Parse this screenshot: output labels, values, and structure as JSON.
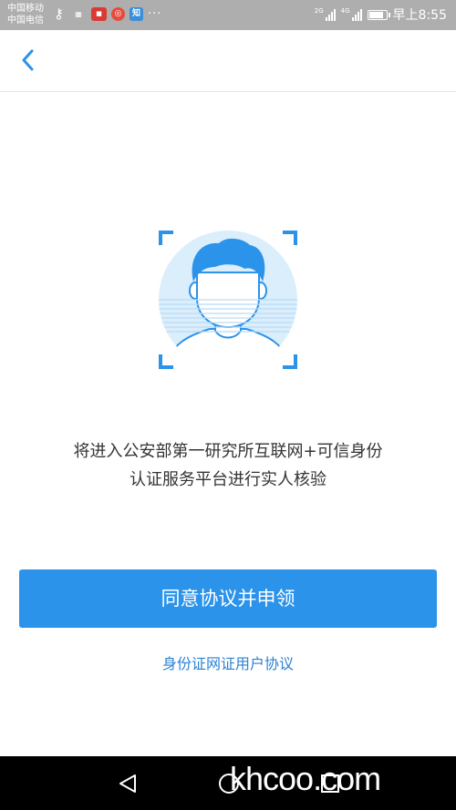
{
  "status_bar": {
    "carrier_1": "中国移动",
    "carrier_2": "中国电信",
    "net_label_1": "2G",
    "net_label_2": "4G",
    "time": "早上8:55",
    "battery_level": 0.85
  },
  "nav": {
    "back_icon": "chevron-left-icon"
  },
  "illustration": {
    "icon": "face-scan-icon",
    "accent_color": "#2c93ea"
  },
  "content": {
    "description_line1": "将进入公安部第一研究所互联网+可信身份",
    "description_line2": "认证服务平台进行实人核验"
  },
  "actions": {
    "agree_button_label": "同意协议并申领",
    "agreement_link_label": "身份证网证用户协议"
  },
  "system_nav": {
    "watermark": "khcoo.com"
  },
  "colors": {
    "primary": "#2c93ea",
    "link": "#2c82d4",
    "status_bar_bg": "#aeaeae"
  }
}
